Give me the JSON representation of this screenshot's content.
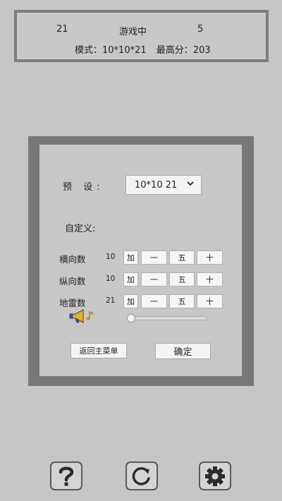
{
  "status": {
    "left_value": "21",
    "state": "游戏中",
    "right_value": "5",
    "mode_label": "模式：",
    "mode_value": "10*10*21",
    "best_label": "最高分：",
    "best_value": "203"
  },
  "settings": {
    "preset_label": "预 设:",
    "preset_value": "10*10  21",
    "custom_label": "自定义:",
    "rows": [
      {
        "name": "横向数",
        "value": "10"
      },
      {
        "name": "纵向数",
        "value": "10"
      },
      {
        "name": "地雷数",
        "value": "21"
      }
    ],
    "step_buttons": {
      "add": "加",
      "minus": "一",
      "five": "五",
      "ten": "十"
    },
    "volume_level": 0.0,
    "back_label": "返回主菜单",
    "ok_label": "确定"
  },
  "toolbar": {
    "icons": [
      "question-icon",
      "refresh-icon",
      "gear-icon"
    ]
  }
}
